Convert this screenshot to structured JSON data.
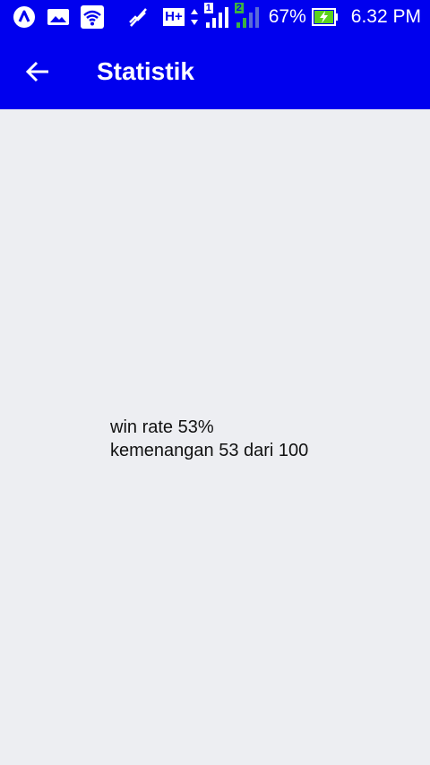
{
  "status_bar": {
    "battery_percent": "67%",
    "time": "6.32 PM",
    "network_type": "H+",
    "sim1_label": "1",
    "sim2_label": "2",
    "icons": [
      "app-notification-icon",
      "image-notification-icon",
      "wifi-icon",
      "mute-icon",
      "data-arrows-icon",
      "signal-sim1-icon",
      "signal-sim2-icon",
      "battery-charging-icon"
    ]
  },
  "toolbar": {
    "title": "Statistik",
    "back_icon": "arrow-left-icon"
  },
  "stats": {
    "win_rate_text": "win rate 53%",
    "wins_text": "kemenangan 53 dari 100"
  },
  "colors": {
    "primary": "#0000ee",
    "background": "#edeef2",
    "text": "#111111",
    "sim2_accent": "#3cb043",
    "battery_bolt": "#5bd31c"
  }
}
